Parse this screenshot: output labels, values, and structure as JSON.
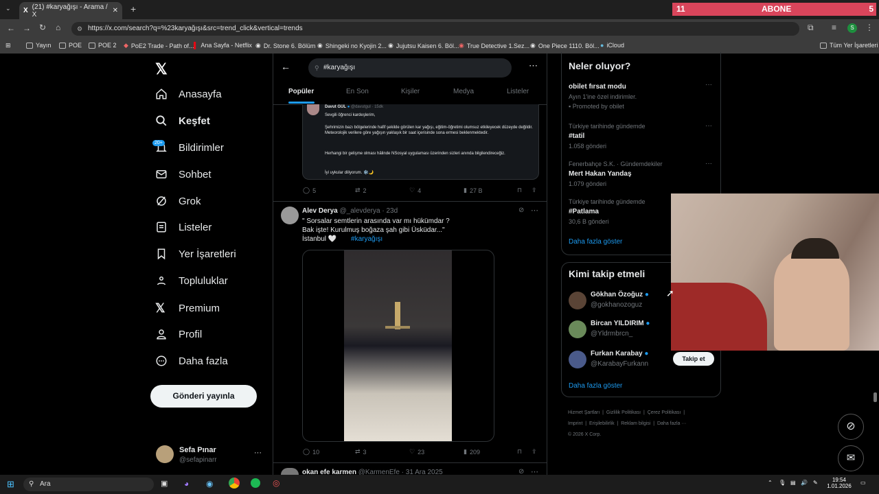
{
  "browser": {
    "tab_title": "(21) #karyağışı - Arama / X",
    "url": "https://x.com/search?q=%23karyağışı&src=trend_click&vertical=trends",
    "bookmarks": [
      "Yayın",
      "POE",
      "POE 2",
      "PoE2 Trade - Path of...",
      "Ana Sayfa - Netflix",
      "Dr. Stone 6. Bölüm",
      "Shingeki no Kyojin 2...",
      "Jujutsu Kaisen 6. Böl...",
      "True Detective 1.Sez...",
      "One Piece 1110. Böl...",
      "iCloud"
    ],
    "all_bookmarks": "Tüm Yer İşaretleri",
    "profile_letter": "S"
  },
  "overlay": {
    "left": "11",
    "center": "ABONE",
    "right": "5"
  },
  "nav": {
    "items": [
      "Anasayfa",
      "Keşfet",
      "Bildirimler",
      "Sohbet",
      "Grok",
      "Listeler",
      "Yer İşaretleri",
      "Topluluklar",
      "Premium",
      "Profil",
      "Daha fazla"
    ],
    "badge": "20+",
    "post_button": "Gönderi yayınla",
    "user_name": "Sefa Pınar",
    "user_handle": "@sefapinarr"
  },
  "search": {
    "query": "#karyağışı",
    "tabs": [
      "Popüler",
      "En Son",
      "Kişiler",
      "Medya",
      "Listeler"
    ]
  },
  "tweet1": {
    "name": "Davut GÜL",
    "handle": "@davutgul · 15dk",
    "lines": [
      "Sevgili öğrenci kardeşlerim,",
      "Şehrimizin bazı bölgelerinde hafif şekilde görülen kar yağışı, eğitim-öğretimi olumsuz etkileyecek düzeyde değildir. Meteorolojik verilere göre yağışın yaklaşık bir saat içerisinde sona ermesi beklenmektedir.",
      "Herhangi bir gelişme olması hâlinde NSosyal uygulaması üzerinden sizleri anında bilgilendireceğiz.",
      "İyi uykular diliyorum. ❄️🌙"
    ],
    "replies": "5",
    "reposts": "2",
    "likes": "4",
    "views": "27 B"
  },
  "tweet2": {
    "name": "Alev Derya",
    "handle": "@_alevderya · 23d",
    "line1": "\" Sorsalar semtlerin arasında var mı hükümdar ?",
    "line2": "Bak işte! Kurulmuş boğaza şah gibi Üsküdar...\"",
    "line3": "İstanbul 🤍",
    "hashtag": "#karyağışı",
    "replies": "10",
    "reposts": "3",
    "likes": "23",
    "views": "209"
  },
  "tweet3": {
    "name": "okan efe karmen",
    "handle": "@KarmenEfe · 31 Ara 2025"
  },
  "trends": {
    "header": "Neler oluyor?",
    "items": [
      {
        "title": "obilet fırsat modu",
        "sub": "Ayın 1'ine özel indirimler.",
        "meta": "Promoted by obilet"
      },
      {
        "context": "Türkiye tarihinde gündemde",
        "title": "#tatil",
        "count": "1.058 gönderi"
      },
      {
        "context": "Fenerbahçe S.K. · Gündemdekiler",
        "title": "Mert Hakan Yandaş",
        "count": "1.079 gönderi"
      },
      {
        "context": "Türkiye tarihinde gündemde",
        "title": "#Patlama",
        "count": "30,6 B gönderi"
      }
    ],
    "more": "Daha fazla göster"
  },
  "who_to_follow": {
    "header": "Kimi takip etmeli",
    "users": [
      {
        "name": "Gökhan Özoğuz",
        "handle": "@gokhanozoguz"
      },
      {
        "name": "Bircan YILDIRIM",
        "handle": "@Yldrmbrcn_"
      },
      {
        "name": "Furkan Karabay",
        "handle": "@KarabayFurkann"
      }
    ],
    "follow_button": "Takip et",
    "more": "Daha fazla göster"
  },
  "footer": {
    "links": [
      "Hizmet Şartları",
      "Gizlilik Politikası",
      "Çerez Politikası",
      "Imprint",
      "Erişilebilirlik",
      "Reklam bilgisi",
      "Daha fazla ···"
    ],
    "copyright": "© 2026 X Corp."
  },
  "taskbar": {
    "search": "Ara",
    "time": "19:54",
    "date": "1.01.2026"
  },
  "colors": {
    "accent": "#1d9bf0",
    "overlay": "#d9455b"
  }
}
